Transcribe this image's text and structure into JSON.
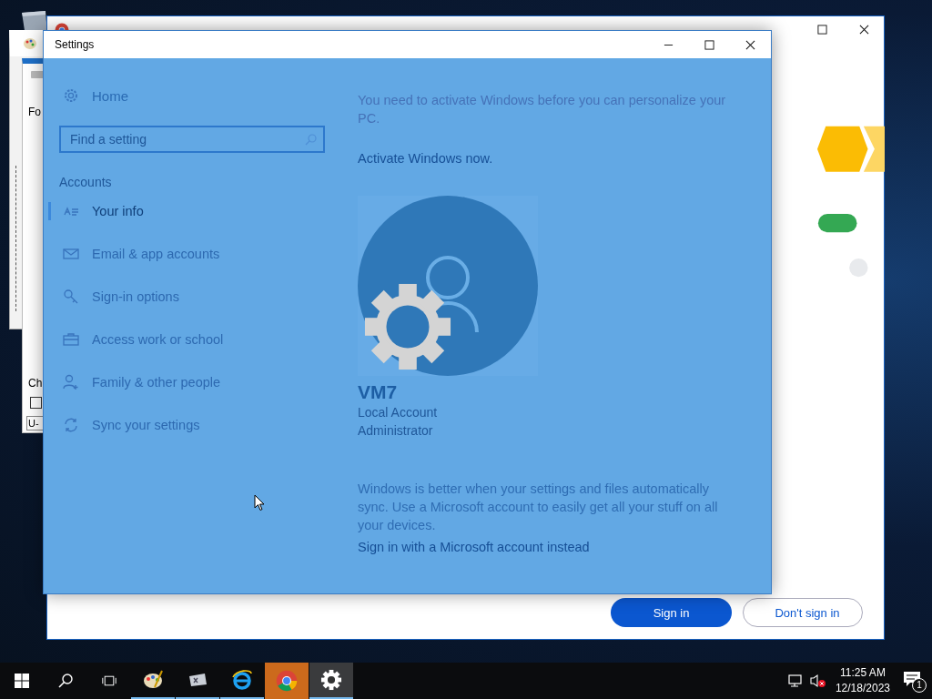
{
  "chrome_window": {
    "primary_button": "Sign in",
    "secondary_button": "Don't sign in"
  },
  "back_window": {
    "texts": [
      "Fo",
      "Ch",
      "U-"
    ],
    "checked": false
  },
  "settings": {
    "title": "Settings",
    "home": "Home",
    "search": {
      "placeholder": "Find a setting"
    },
    "section": "Accounts",
    "nav": [
      {
        "label": "Your info",
        "kind": "user-card",
        "selected": true
      },
      {
        "label": "Email & app accounts",
        "kind": "mail",
        "selected": false
      },
      {
        "label": "Sign-in options",
        "kind": "key",
        "selected": false
      },
      {
        "label": "Access work or school",
        "kind": "briefcase",
        "selected": false
      },
      {
        "label": "Family & other people",
        "kind": "person-add",
        "selected": false
      },
      {
        "label": "Sync your settings",
        "kind": "sync",
        "selected": false
      }
    ],
    "notice": "You need to activate Windows before you can personalize your PC.",
    "activate_link": "Activate Windows now.",
    "account": {
      "name": "VM7",
      "type": "Local Account",
      "role": "Administrator"
    },
    "sync_text": "Windows is better when your settings and files automatically sync. Use a Microsoft account to easily get all your stuff on all your devices.",
    "sign_in_link": "Sign in with a Microsoft account instead"
  },
  "taskbar": {
    "apps": [
      {
        "kind": "paint",
        "running": true,
        "flashing": false,
        "active": false
      },
      {
        "kind": "keyboard",
        "running": true,
        "flashing": false,
        "active": false
      },
      {
        "kind": "browser-e",
        "running": true,
        "flashing": false,
        "active": false
      },
      {
        "kind": "chrome",
        "running": false,
        "flashing": true,
        "active": false
      },
      {
        "kind": "gear",
        "running": true,
        "flashing": false,
        "active": true
      }
    ],
    "time": "11:25 AM",
    "date": "12/18/2023",
    "notification_count": "1",
    "muted": true
  }
}
